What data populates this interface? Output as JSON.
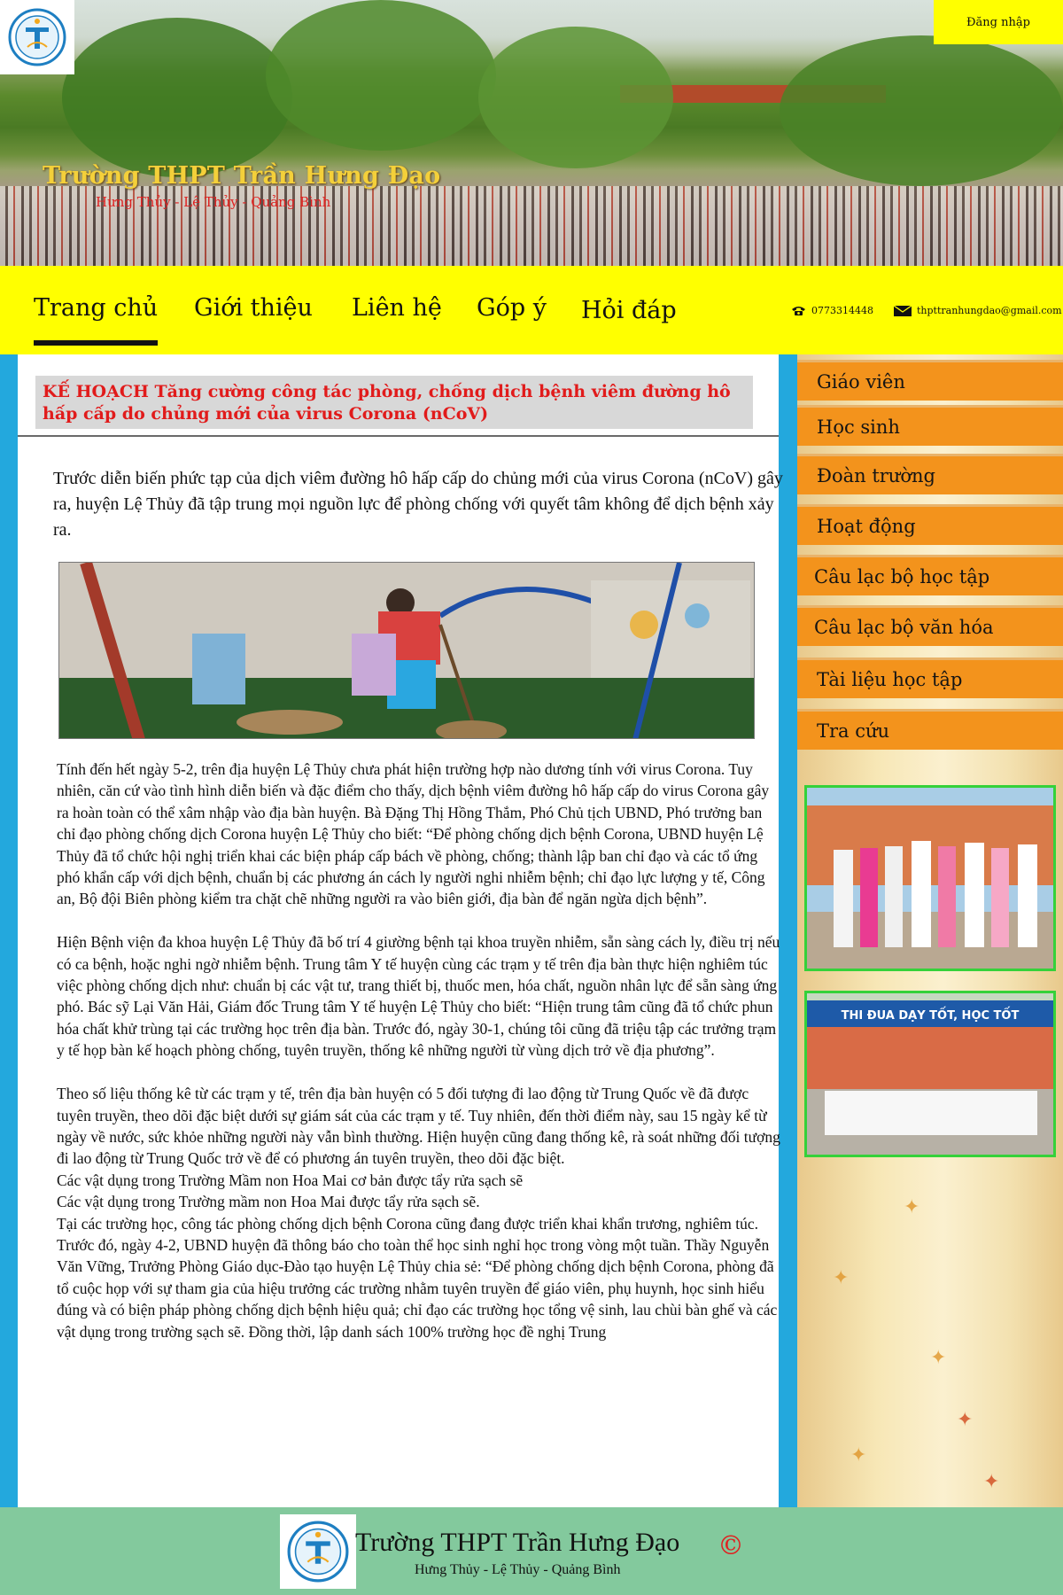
{
  "header": {
    "login_label": "Đăng nhập",
    "school_name": "Trường THPT Trần Hưng Đạo",
    "school_address": "Hưng Thủy - Lệ Thủy - Quảng Bình",
    "logo_icon": "school-logo-icon"
  },
  "nav": {
    "items": [
      {
        "label": "Trang chủ"
      },
      {
        "label": "Giới thiệu"
      },
      {
        "label": "Liên hệ"
      },
      {
        "label": "Góp ý"
      },
      {
        "label": "Hỏi đáp"
      }
    ],
    "active_index": 0,
    "phone": "0773314448",
    "email": "thpttranhungdao@gmail.com"
  },
  "article": {
    "heading": "KẾ HOẠCH Tăng cường công tác phòng, chống dịch bệnh  viêm đường hô hấp cấp do chủng mới của virus Corona (nCoV)",
    "lead": "Trước diễn biến phức tạp của dịch viêm đường hô hấp cấp do chủng mới của virus Corona (nCoV) gây ra, huyện Lệ Thủy đã tập trung mọi nguồn lực để phòng chống với quyết tâm không để dịch bệnh xảy ra.",
    "body": "Tính đến hết ngày 5-2, trên địa huyện Lệ Thủy chưa phát hiện trường hợp nào dương tính với virus Corona. Tuy nhiên, căn cứ vào tình hình diễn biến và đặc điểm cho thấy, dịch bệnh viêm đường hô hấp cấp do virus Corona gây ra hoàn toàn có thể xâm nhập vào địa bàn huyện. Bà Đặng Thị Hồng Thắm, Phó Chủ tịch UBND, Phó trưởng ban chỉ đạo phòng chống dịch Corona huyện Lệ Thủy cho biết: “Để phòng chống dịch bệnh Corona, UBND huyện Lệ Thủy đã tổ chức hội nghị triển khai các biện pháp cấp bách về phòng, chống; thành lập ban chỉ đạo và các tổ ứng phó khẩn cấp với dịch bệnh, chuẩn bị các phương án cách ly người nghi nhiễm bệnh; chỉ đạo lực lượng y tế, Công an, Bộ đội Biên phòng kiểm tra chặt chẽ những người ra vào biên giới, địa bàn để ngăn ngừa dịch bệnh”.\n\nHiện Bệnh viện đa khoa huyện Lệ Thủy đã bố trí 4 giường bệnh tại khoa truyền nhiễm, sẵn sàng cách ly, điều trị nếu có ca bệnh, hoặc nghi ngờ nhiễm bệnh. Trung tâm Y tế huyện cùng các trạm y tế trên địa bàn thực hiện nghiêm túc việc phòng chống dịch như: chuẩn bị các vật tư, trang thiết bị, thuốc men, hóa chất, nguồn nhân lực để sẵn sàng ứng phó. Bác sỹ Lại Văn Hải, Giám đốc Trung tâm Y tế huyện Lệ Thủy cho biết: “Hiện trung tâm cũng đã tổ chức phun hóa chất khử trùng tại các trường học trên địa bàn. Trước đó, ngày 30-1, chúng tôi cũng đã triệu tập các trưởng trạm y tế họp bàn kế hoạch phòng chống, tuyên truyền, thống kê những người từ vùng dịch trở về địa phương”.\n\nTheo số liệu thống kê từ các trạm y tế, trên địa bàn huyện có 5 đối tượng đi lao động từ Trung Quốc về đã được tuyên truyền, theo dõi đặc biệt dưới sự giám sát của các trạm y tế. Tuy nhiên, đến thời điểm này, sau 15 ngày kể từ ngày về nước, sức khỏe những người này vẫn bình thường. Hiện huyện cũng đang thống kê, rà soát những đối tượng đi lao động từ Trung Quốc trở về để có phương án tuyên truyền, theo dõi đặc biệt.\nCác vật dụng trong Trường Mầm non Hoa Mai cơ bản được tẩy rửa sạch sẽ\nCác vật dụng trong Trường mầm non Hoa Mai được tẩy rửa sạch sẽ.\nTại các trường học, công tác phòng chống dịch bệnh Corona cũng đang được triển khai khẩn trương, nghiêm túc. Trước đó, ngày 4-2, UBND huyện đã thông báo cho toàn thể học sinh nghỉ học trong vòng một tuần. Thầy Nguyễn Văn Vững, Trưởng Phòng Giáo dục-Đào tạo huyện Lệ Thủy chia sẻ: “Để phòng chống dịch bệnh Corona, phòng đã tổ cuộc họp với sự tham gia của hiệu trưởng các trường nhằm tuyên truyền để giáo viên, phụ huynh, học sinh hiểu đúng và có biện pháp phòng chống dịch bệnh hiệu quả; chỉ đạo các trường học tổng vệ sinh, lau chùi bàn ghế và các vật dụng trong trường sạch sẽ. Đồng thời, lập danh sách 100% trường học đề nghị Trung"
  },
  "sidebar": {
    "menu": [
      {
        "label": "Giáo viên"
      },
      {
        "label": "Học sinh"
      },
      {
        "label": "Đoàn trường"
      },
      {
        "label": "Hoạt động"
      },
      {
        "label": "Câu lạc bộ học tập"
      },
      {
        "label": "Câu lạc bộ văn hóa"
      },
      {
        "label": "Tài liệu học tập"
      },
      {
        "label": "Tra cứu"
      }
    ],
    "photo2_banner": "THI ĐUA DẠY TỐT, HỌC TỐT"
  },
  "footer": {
    "school_name": "Trường THPT Trần Hưng Đạo",
    "school_address": "Hưng Thủy - Lệ Thủy - Quảng Bình",
    "copyright_symbol": "©"
  },
  "colors": {
    "nav_bg": "#ffff00",
    "side_menu_bg": "#f3931c",
    "heading_red": "#e11b1b",
    "content_frame_blue": "#23a8dd",
    "footer_bg": "#83c99d",
    "photo_border_green": "#35d13a"
  }
}
